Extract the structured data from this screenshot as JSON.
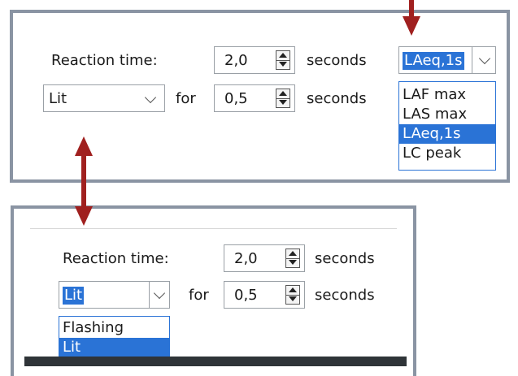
{
  "top_panel": {
    "reaction_label": "Reaction time:",
    "reaction_value": "2,0",
    "reaction_unit": "seconds",
    "state_select": {
      "value": "Lit"
    },
    "for_label": "for",
    "duration_value": "0,5",
    "duration_unit": "seconds",
    "param_select": {
      "value": "LAeq,1s",
      "options": [
        "LAF max",
        "LAS max",
        "LAeq,1s",
        "LC peak"
      ],
      "highlighted": "LAeq,1s"
    }
  },
  "bottom_panel": {
    "reaction_label": "Reaction time:",
    "reaction_value": "2,0",
    "reaction_unit": "seconds",
    "state_select": {
      "value": "Lit",
      "options": [
        "Flashing",
        "Lit"
      ],
      "highlighted": "Lit"
    },
    "for_label": "for",
    "duration_value": "0,5",
    "duration_unit": "seconds"
  },
  "colors": {
    "arrow": "#a0201f",
    "selection": "#2a73d6",
    "panel_border": "#8a94a3"
  }
}
